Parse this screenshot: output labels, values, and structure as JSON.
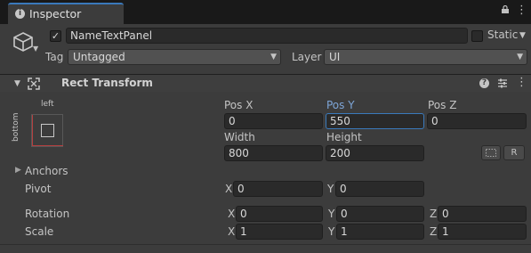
{
  "tab": {
    "label": "Inspector"
  },
  "object": {
    "active": true,
    "active_mark": "✓",
    "name": "NameTextPanel",
    "static_label": "Static",
    "tag_label": "Tag",
    "tag_value": "Untagged",
    "layer_label": "Layer",
    "layer_value": "UI"
  },
  "component": {
    "title": "Rect Transform",
    "anchor_preset": {
      "horizontal": "left",
      "vertical": "bottom"
    },
    "pos": {
      "x_label": "Pos X",
      "x": "0",
      "y_label": "Pos Y",
      "y": "550",
      "z_label": "Pos Z",
      "z": "0"
    },
    "size": {
      "width_label": "Width",
      "width": "800",
      "height_label": "Height",
      "height": "200"
    },
    "blueprint_button": "",
    "raw_button": "R",
    "anchors_label": "Anchors",
    "pivot": {
      "label": "Pivot",
      "x_axis": "X",
      "x": "0",
      "y_axis": "Y",
      "y": "0"
    },
    "rotation": {
      "label": "Rotation",
      "x_axis": "X",
      "x": "0",
      "y_axis": "Y",
      "y": "0",
      "z_axis": "Z",
      "z": "0"
    },
    "scale": {
      "label": "Scale",
      "x_axis": "X",
      "x": "1",
      "y_axis": "Y",
      "y": "1",
      "z_axis": "Z",
      "z": "1"
    }
  },
  "icons": {
    "info": "info-icon",
    "lock": "lock-icon",
    "menu": "kebab-menu-icon",
    "gameobject": "cube-icon",
    "rect_transform": "rect-transform-icon",
    "help": "help-icon",
    "presets": "presets-icon"
  },
  "colors": {
    "accent": "#3a79bb",
    "focus_label": "#7ea6d8",
    "anchor_line": "#b53f3f"
  }
}
